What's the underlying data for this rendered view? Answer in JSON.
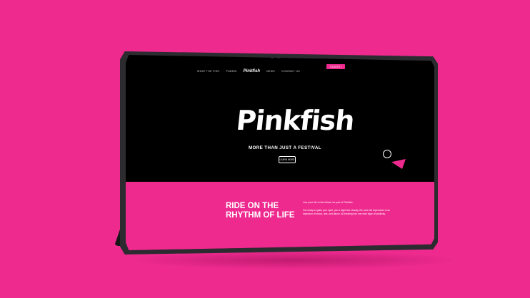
{
  "nav": {
    "items": [
      "WHAT THE FISH",
      "PUBNIS",
      "NEWS",
      "CONTACT US"
    ],
    "logo": "Pinkfish",
    "cta": "TICKETS"
  },
  "hero": {
    "logo": "Pinkfish",
    "tagline": "MORE THAN JUST A FESTIVAL",
    "button": "LEARN MORE"
  },
  "band": {
    "title": "RIDE ON THE RHYTHM OF LIFE",
    "lead": "Live your life to the fullest, be part of Pinkfish.",
    "body": "Get ready to ignite your spirit, join a night fest vivacity, life, and self expression in an explosion of music, arts, and dance. All bending into one vivid hype of positivity."
  }
}
